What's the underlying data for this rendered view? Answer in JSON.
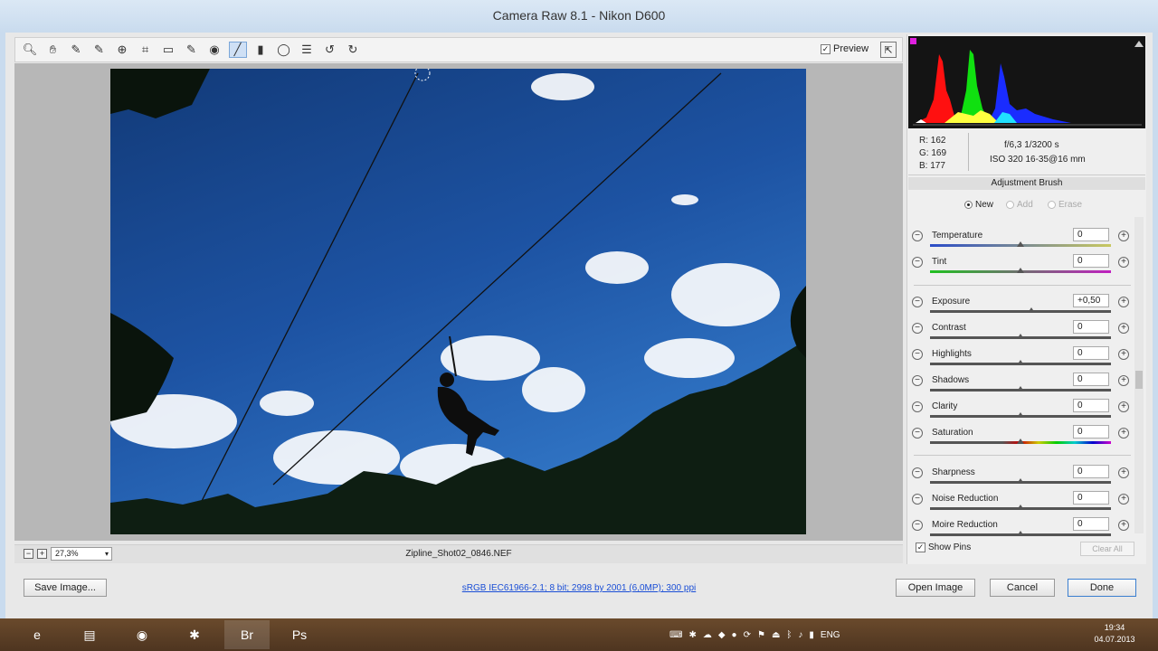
{
  "window": {
    "title": "Camera Raw 8.1  -  Nikon D600"
  },
  "toolbar": {
    "tools": [
      {
        "name": "zoom-icon",
        "glyph": "🔍︎"
      },
      {
        "name": "hand-icon",
        "glyph": "✋︎"
      },
      {
        "name": "white-balance-icon",
        "glyph": "✎"
      },
      {
        "name": "color-sampler-icon",
        "glyph": "✎"
      },
      {
        "name": "targeted-adjustment-icon",
        "glyph": "⊕"
      },
      {
        "name": "crop-icon",
        "glyph": "⌗"
      },
      {
        "name": "straighten-icon",
        "glyph": "▭"
      },
      {
        "name": "spot-removal-icon",
        "glyph": "✎"
      },
      {
        "name": "red-eye-icon",
        "glyph": "◉"
      },
      {
        "name": "adjustment-brush-icon",
        "glyph": "╱"
      },
      {
        "name": "graduated-filter-icon",
        "glyph": "▮"
      },
      {
        "name": "radial-filter-icon",
        "glyph": "◯"
      },
      {
        "name": "preferences-icon",
        "glyph": "☰"
      },
      {
        "name": "rotate-left-icon",
        "glyph": "↺"
      },
      {
        "name": "rotate-right-icon",
        "glyph": "↻"
      }
    ],
    "preview_label": "Preview",
    "preview_check": "✓",
    "fullscreen_glyph": "⇱"
  },
  "status": {
    "zoom": "27,3%",
    "zoom_minus": "−",
    "zoom_plus": "+",
    "zoom_dd": "▾",
    "filename": "Zipline_Shot02_0846.NEF"
  },
  "readout": {
    "r": "R:  162",
    "g": "G:  169",
    "b": "B:  177",
    "aperture_shutter": "f/6,3    1/3200 s",
    "iso_lens": "ISO 320    16-35@16 mm"
  },
  "panel": {
    "title": "Adjustment Brush",
    "mode_new": "New",
    "mode_add": "Add",
    "mode_erase": "Erase"
  },
  "sliders": [
    {
      "label": "Temperature",
      "value": "0",
      "pos": 0.5
    },
    {
      "label": "Tint",
      "value": "0",
      "pos": 0.5
    },
    {
      "label": "Exposure",
      "value": "+0,50",
      "pos": 0.56
    },
    {
      "label": "Contrast",
      "value": "0",
      "pos": 0.5
    },
    {
      "label": "Highlights",
      "value": "0",
      "pos": 0.5
    },
    {
      "label": "Shadows",
      "value": "0",
      "pos": 0.5
    },
    {
      "label": "Clarity",
      "value": "0",
      "pos": 0.5
    },
    {
      "label": "Saturation",
      "value": "0",
      "pos": 0.5
    },
    {
      "label": "Sharpness",
      "value": "0",
      "pos": 0.5
    },
    {
      "label": "Noise Reduction",
      "value": "0",
      "pos": 0.5
    },
    {
      "label": "Moire Reduction",
      "value": "0",
      "pos": 0.5
    }
  ],
  "slider_minus": "−",
  "slider_plus": "+",
  "show_pins": "Show Pins",
  "show_pins_check": "✓",
  "clear_all": "Clear All",
  "buttons": {
    "save": "Save Image...",
    "open": "Open Image",
    "cancel": "Cancel",
    "done": "Done"
  },
  "workflow_link": "sRGB IEC61966-2.1; 8 bit; 2998 by 2001 (6,0MP); 300 ppi",
  "taskbar": {
    "apps": [
      {
        "name": "ie-icon",
        "glyph": "e"
      },
      {
        "name": "explorer-icon",
        "glyph": "▤"
      },
      {
        "name": "chrome-icon",
        "glyph": "◉"
      },
      {
        "name": "snowflake-app-icon",
        "glyph": "✱"
      },
      {
        "name": "bridge-icon",
        "glyph": "Br"
      },
      {
        "name": "photoshop-icon",
        "glyph": "Ps"
      }
    ],
    "lang": "ENG",
    "time": "19:34",
    "date": "04.07.2013"
  },
  "colors": {
    "accent": "#3b7fd0",
    "taskbar": "#5a3d24",
    "titlebar": "#c9dbee"
  }
}
